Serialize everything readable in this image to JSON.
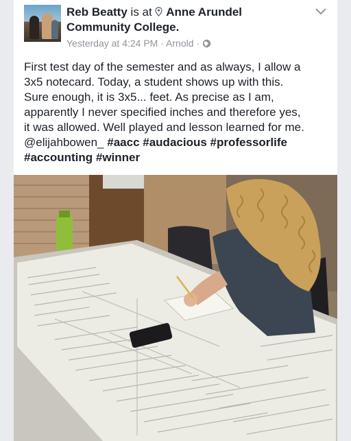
{
  "post": {
    "author": "Reb Beatty",
    "is_at": "is at",
    "place_line1": "Anne Arundel",
    "place_line2": "Community College.",
    "timestamp": "Yesterday at 4:24 PM",
    "separator": "·",
    "location_short": "Arnold",
    "privacy_icon": "globe-icon",
    "options_icon": "chevron-down-icon",
    "text_lines": [
      "First test day of the semester and as always, I allow a",
      "3x5 notecard.  Today, a student shows up with this.",
      "Sure enough, it is 3x5... feet.  As precise as I am,",
      "apparently I never specified inches and therefore yes,",
      "it was allowed.  Well played and lesson learned for me."
    ],
    "mention": "@elijahbowen_",
    "hashtags_line1": [
      "#aacc",
      "#audacious",
      "#professorlife"
    ],
    "hashtags_line2": [
      "#accounting",
      "#winner"
    ]
  }
}
